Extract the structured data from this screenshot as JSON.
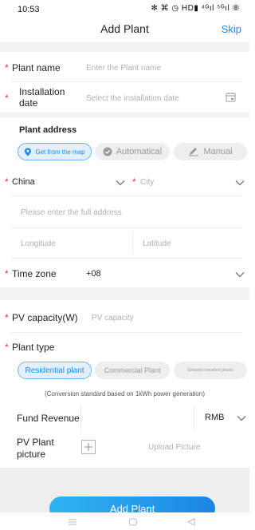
{
  "status": {
    "time": "10:53",
    "icons": "✻ ⌘ ◷ HD▮ ⁴ᴳıl ⁵ᴳıl ⑧"
  },
  "header": {
    "title": "Add Plant",
    "skip": "Skip"
  },
  "form": {
    "required_mark": "*",
    "plant_name": {
      "label": "Plant name",
      "placeholder": "Enter the Plant name"
    },
    "installation_date": {
      "label_line1": "Installation",
      "label_line2": "date",
      "placeholder": "Select the installation date"
    },
    "plant_address": {
      "heading": "Plant address",
      "tabs": [
        {
          "label": "Get from the map",
          "icon": "location-pin-icon",
          "active": true
        },
        {
          "label": "Automatical",
          "icon": "check-circle-icon",
          "active": false
        },
        {
          "label": "Manual",
          "icon": "pencil-icon",
          "active": false
        }
      ],
      "country": "China",
      "city_placeholder": "City",
      "full_address_placeholder": "Please enter the full address",
      "longitude_placeholder": "Longitude",
      "latitude_placeholder": "Latitude"
    },
    "time_zone": {
      "label": "Time zone",
      "value": "+08"
    },
    "pv_capacity": {
      "label": "PV capacity(W)",
      "placeholder": "PV capacity"
    },
    "plant_type": {
      "label": "Plant type",
      "options": [
        {
          "label": "Residential plant",
          "active": true
        },
        {
          "label": "Commercial Plant",
          "active": false
        },
        {
          "label": "Ground-mounted plants",
          "active": false
        }
      ],
      "note": "(Conversion standard based on 1kWh power generation)"
    },
    "fund_revenue": {
      "label": "Fund Revenue",
      "currency": "RMB"
    },
    "pv_picture": {
      "label_line1": "PV Plant",
      "label_line2": "picture",
      "upload": "Upload Picture"
    }
  },
  "footer": {
    "add_button": "Add Plant"
  },
  "colors": {
    "accent": "#1e88e5",
    "required": "#e53935",
    "background_gap": "#f2f3f5"
  }
}
